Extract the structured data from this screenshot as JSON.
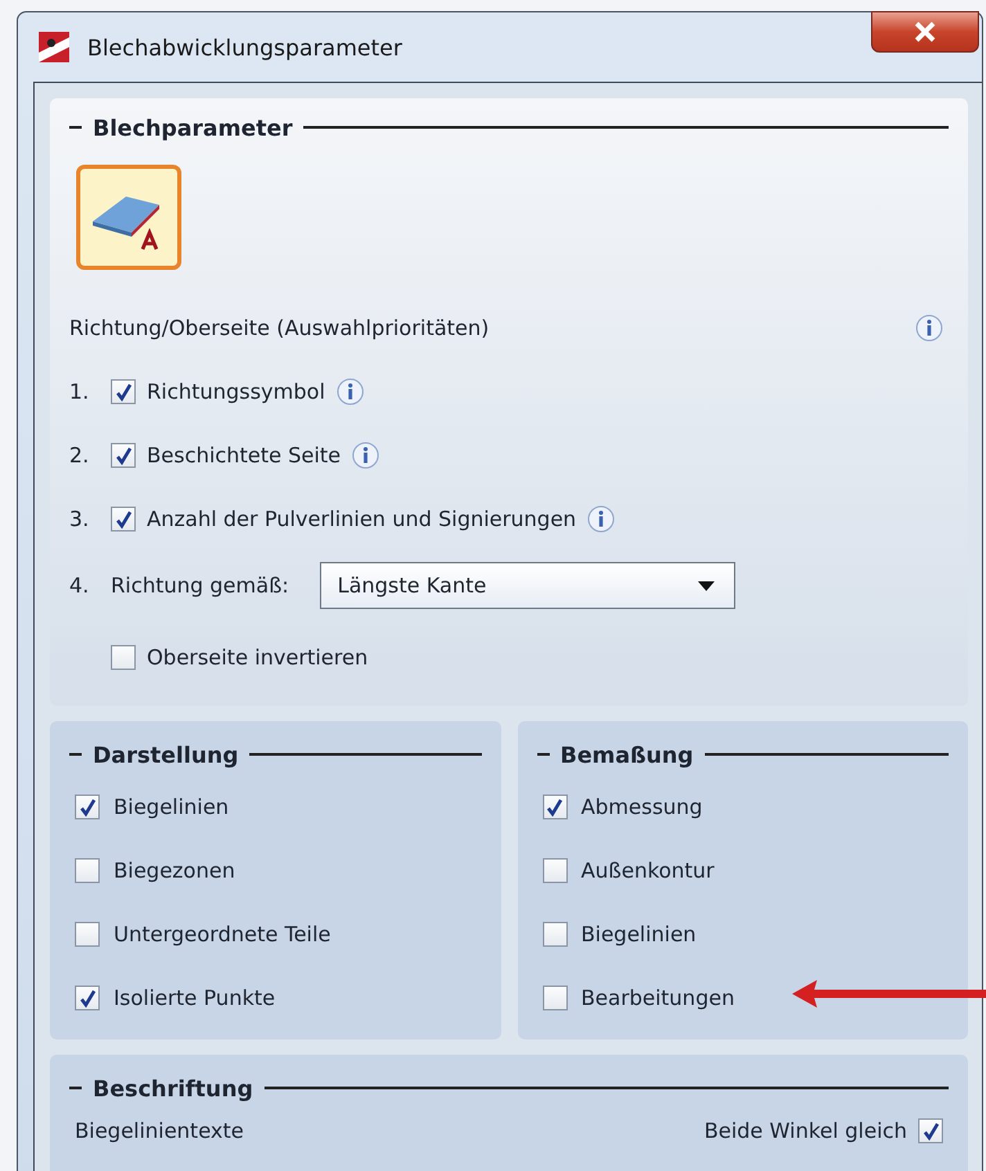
{
  "window": {
    "title": "Blechabwicklungsparameter"
  },
  "blechparameter": {
    "title": "Blechparameter",
    "tool_button": {
      "selected": true
    },
    "priority_heading": "Richtung/Oberseite (Auswahlprioritäten)",
    "priorities": [
      {
        "number": "1.",
        "label": "Richtungssymbol",
        "checked": true
      },
      {
        "number": "2.",
        "label": "Beschichtete Seite",
        "checked": true
      },
      {
        "number": "3.",
        "label": "Anzahl der Pulverlinien und Signierungen",
        "checked": true
      }
    ],
    "direction": {
      "number": "4.",
      "label": "Richtung gemäß:",
      "value": "Längste Kante"
    },
    "invert": {
      "label": "Oberseite invertieren",
      "checked": false
    }
  },
  "darstellung": {
    "title": "Darstellung",
    "options": [
      {
        "label": "Biegelinien",
        "checked": true
      },
      {
        "label": "Biegezonen",
        "checked": false
      },
      {
        "label": "Untergeordnete Teile",
        "checked": false
      },
      {
        "label": "Isolierte Punkte",
        "checked": true
      }
    ]
  },
  "bemassung": {
    "title": "Bemaßung",
    "options": [
      {
        "label": "Abmessung",
        "checked": true
      },
      {
        "label": "Außenkontur",
        "checked": false
      },
      {
        "label": "Biegelinien",
        "checked": false
      },
      {
        "label": "Bearbeitungen",
        "checked": false
      }
    ]
  },
  "beschriftung": {
    "title": "Beschriftung",
    "label": "Biegelinientexte",
    "option": {
      "label": "Beide Winkel gleich",
      "checked": true
    }
  }
}
